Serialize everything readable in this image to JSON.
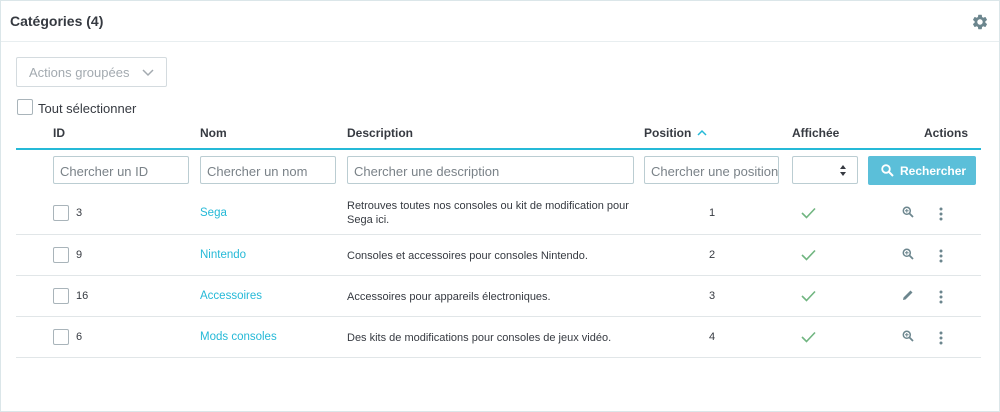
{
  "panel": {
    "title": "Catégories (4)"
  },
  "toolbar": {
    "bulk_label": "Actions groupées",
    "select_all_label": "Tout sélectionner"
  },
  "columns": {
    "id": "ID",
    "name": "Nom",
    "description": "Description",
    "position": "Position",
    "displayed": "Affichée",
    "actions": "Actions"
  },
  "filters": {
    "id_placeholder": "Chercher un ID",
    "name_placeholder": "Chercher un nom",
    "description_placeholder": "Chercher une description",
    "position_placeholder": "Chercher une position",
    "search_label": "Rechercher"
  },
  "rows": [
    {
      "id": "3",
      "name": "Sega",
      "description": "Retrouves toutes nos consoles ou kit de modification pour Sega ici.",
      "position": "1",
      "displayed": true,
      "action_icon": "view-icon"
    },
    {
      "id": "9",
      "name": "Nintendo",
      "description": "Consoles et accessoires pour consoles Nintendo.",
      "position": "2",
      "displayed": true,
      "action_icon": "view-icon"
    },
    {
      "id": "16",
      "name": "Accessoires",
      "description": "Accessoires pour appareils électroniques.",
      "position": "3",
      "displayed": true,
      "action_icon": "edit-icon"
    },
    {
      "id": "6",
      "name": "Mods consoles",
      "description": "Des kits de modifications pour consoles de jeux vidéo.",
      "position": "4",
      "displayed": true,
      "action_icon": "view-icon"
    }
  ],
  "colors": {
    "accent": "#25b9d7",
    "button": "#5bbfd9",
    "check": "#70b580"
  }
}
